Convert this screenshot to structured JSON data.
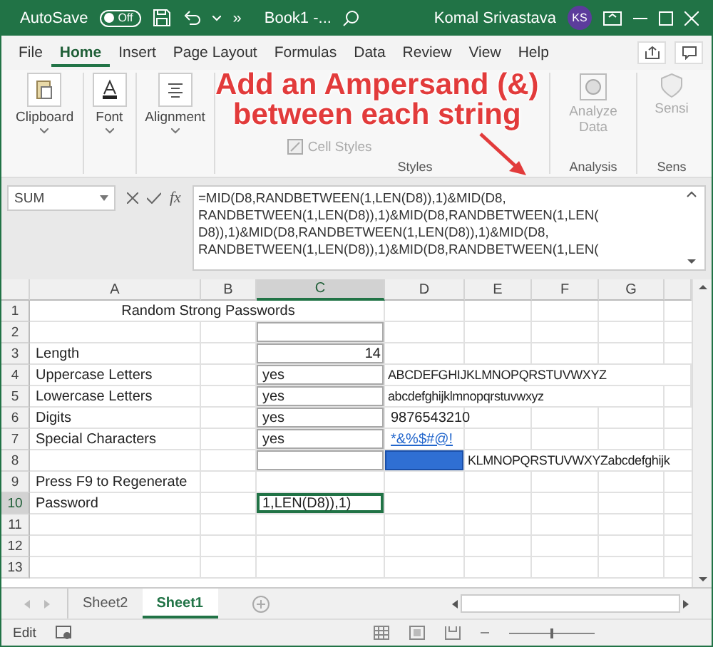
{
  "title_bar": {
    "autosave_label": "AutoSave",
    "autosave_toggle": {
      "label": "Off",
      "on": false
    },
    "more": "»",
    "document_title": "Book1 -...",
    "user_name": "Komal Srivastava",
    "avatar_initials": "KS"
  },
  "ribbon_tabs": [
    {
      "label": "File",
      "selected": false
    },
    {
      "label": "Home",
      "selected": true
    },
    {
      "label": "Insert",
      "selected": false
    },
    {
      "label": "Page Layout",
      "selected": false
    },
    {
      "label": "Formulas",
      "selected": false
    },
    {
      "label": "Data",
      "selected": false
    },
    {
      "label": "Review",
      "selected": false
    },
    {
      "label": "View",
      "selected": false
    },
    {
      "label": "Help",
      "selected": false
    }
  ],
  "ribbon_groups": [
    {
      "kind": "clipboard",
      "label": "Clipboard"
    },
    {
      "kind": "font",
      "label": "Font"
    },
    {
      "kind": "alignment",
      "label": "Alignment"
    },
    {
      "kind": "styles",
      "item": "Cell Styles",
      "label": "Styles"
    },
    {
      "kind": "analysis",
      "button": "Analyze Data",
      "label": "Analysis"
    },
    {
      "kind": "sensitivity",
      "button": "Sensi",
      "label": "Sens"
    }
  ],
  "annotation": {
    "lines": [
      "Add an Ampersand (&)",
      "between each string"
    ]
  },
  "formula_bar": {
    "name_box": "SUM",
    "fx": "fx",
    "lines": [
      "=MID(D8,RANDBETWEEN(1,LEN(D8)),1)&MID(D8,",
      "RANDBETWEEN(1,LEN(D8)),1)&MID(D8,RANDBETWEEN(1,LEN(",
      "D8)),1)&MID(D8,RANDBETWEEN(1,LEN(D8)),1)&MID(D8,",
      "RANDBETWEEN(1,LEN(D8)),1)&MID(D8,RANDBETWEEN(1,LEN("
    ]
  },
  "columns": [
    "A",
    "B",
    "C",
    "D",
    "E",
    "F",
    "G"
  ],
  "rows": [
    {
      "number": "1",
      "cells": [
        {
          "text": "Random Strong Passwords",
          "kind": "merged"
        },
        {},
        {},
        {},
        {}
      ]
    },
    {
      "number": "2",
      "cells": [
        {},
        {},
        {
          "bordered": true
        },
        {},
        {},
        {},
        {}
      ]
    },
    {
      "number": "3",
      "cells": [
        {
          "text": "Length"
        },
        {},
        {
          "text": "14",
          "kind": "number",
          "bordered": true
        },
        {},
        {},
        {},
        {}
      ]
    },
    {
      "number": "4",
      "cells": [
        {
          "text": "Uppercase Letters"
        },
        {},
        {
          "text": "yes",
          "bordered": true
        },
        {
          "text": "ABCDEFGHIJKLMNOPQRSTUVWXYZ",
          "kind": "spill"
        },
        {}
      ]
    },
    {
      "number": "5",
      "cells": [
        {
          "text": "Lowercase Letters"
        },
        {},
        {
          "text": "yes",
          "bordered": true
        },
        {
          "text": "abcdefghijklmnopqrstuvwxyz",
          "kind": "spill"
        },
        {},
        {}
      ]
    },
    {
      "number": "6",
      "cells": [
        {
          "text": "Digits"
        },
        {},
        {
          "text": "yes",
          "bordered": true
        },
        {
          "text": "9876543210"
        },
        {},
        {},
        {}
      ]
    },
    {
      "number": "7",
      "cells": [
        {
          "text": "Special Characters"
        },
        {},
        {
          "text": "yes",
          "bordered": true
        },
        {
          "text": "*&%$#@!",
          "kind": "link"
        },
        {},
        {},
        {}
      ]
    },
    {
      "number": "8",
      "cells": [
        {},
        {},
        {
          "bordered": true
        },
        {
          "selected": true
        },
        {
          "text": "KLMNOPQRSTUVWXYZabcdefghijk",
          "kind": "spill"
        }
      ]
    },
    {
      "number": "9",
      "cells": [
        {
          "text": "Press F9 to Regenerate"
        },
        {},
        {},
        {},
        {},
        {},
        {}
      ]
    },
    {
      "number": "10",
      "cells": [
        {
          "text": "Password"
        },
        {},
        {
          "text": "1,LEN(D8)),1)",
          "active": true
        },
        {},
        {},
        {},
        {}
      ]
    },
    {
      "number": "11",
      "cells": [
        {},
        {},
        {},
        {},
        {},
        {},
        {}
      ]
    },
    {
      "number": "12",
      "cells": [
        {},
        {},
        {},
        {},
        {},
        {},
        {}
      ]
    },
    {
      "number": "13",
      "cells": [
        {},
        {},
        {},
        {},
        {},
        {},
        {}
      ]
    }
  ],
  "sheet_tabs": [
    {
      "label": "Sheet2",
      "selected": false
    },
    {
      "label": "Sheet1",
      "selected": true
    }
  ],
  "status_bar": {
    "mode": "Edit",
    "zoom_slider": {
      "level": 0.5
    }
  }
}
